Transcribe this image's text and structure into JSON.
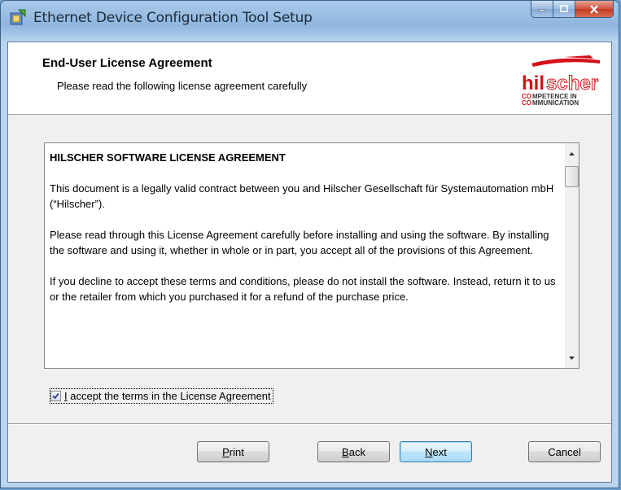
{
  "window": {
    "title": "Ethernet Device Configuration Tool Setup",
    "icon": "installer-icon",
    "caption_buttons": {
      "minimize": "minimize-icon",
      "maximize": "maximize-icon",
      "close": "close-icon"
    }
  },
  "banner": {
    "title": "End-User License Agreement",
    "subtitle": "Please read the following license agreement carefully",
    "logo": {
      "brand_hil": "hil",
      "brand_scher": "scher",
      "line1_co": "CO",
      "line1_rest": "MPETENCE IN",
      "line2_co": "CO",
      "line2_rest": "MMUNICATION"
    }
  },
  "license": {
    "heading": "HILSCHER SOFTWARE LICENSE AGREEMENT",
    "para1": "This document is a legally valid contract between you and Hilscher Gesellschaft für Systemautomation mbH (“Hilscher”).",
    "para2": "Please read through this License Agreement carefully before installing and using the software. By installing the software and using it, whether in whole or in part, you accept all of the provisions of this Agreement.",
    "para3": "If you decline to accept these terms and conditions, please do not install the software. Instead, return it to us or the retailer from which you purchased it for a refund of the purchase price."
  },
  "accept": {
    "checked": true,
    "label_accel": "I",
    "label_rest": " accept the terms in the License Agreement"
  },
  "buttons": {
    "print_accel": "P",
    "print_rest": "rint",
    "back_accel": "B",
    "back_rest": "ack",
    "next_accel": "N",
    "next_rest": "ext",
    "cancel": "Cancel"
  },
  "colors": {
    "accent": "#3c7fb1",
    "brand_red": "#d4101a"
  }
}
